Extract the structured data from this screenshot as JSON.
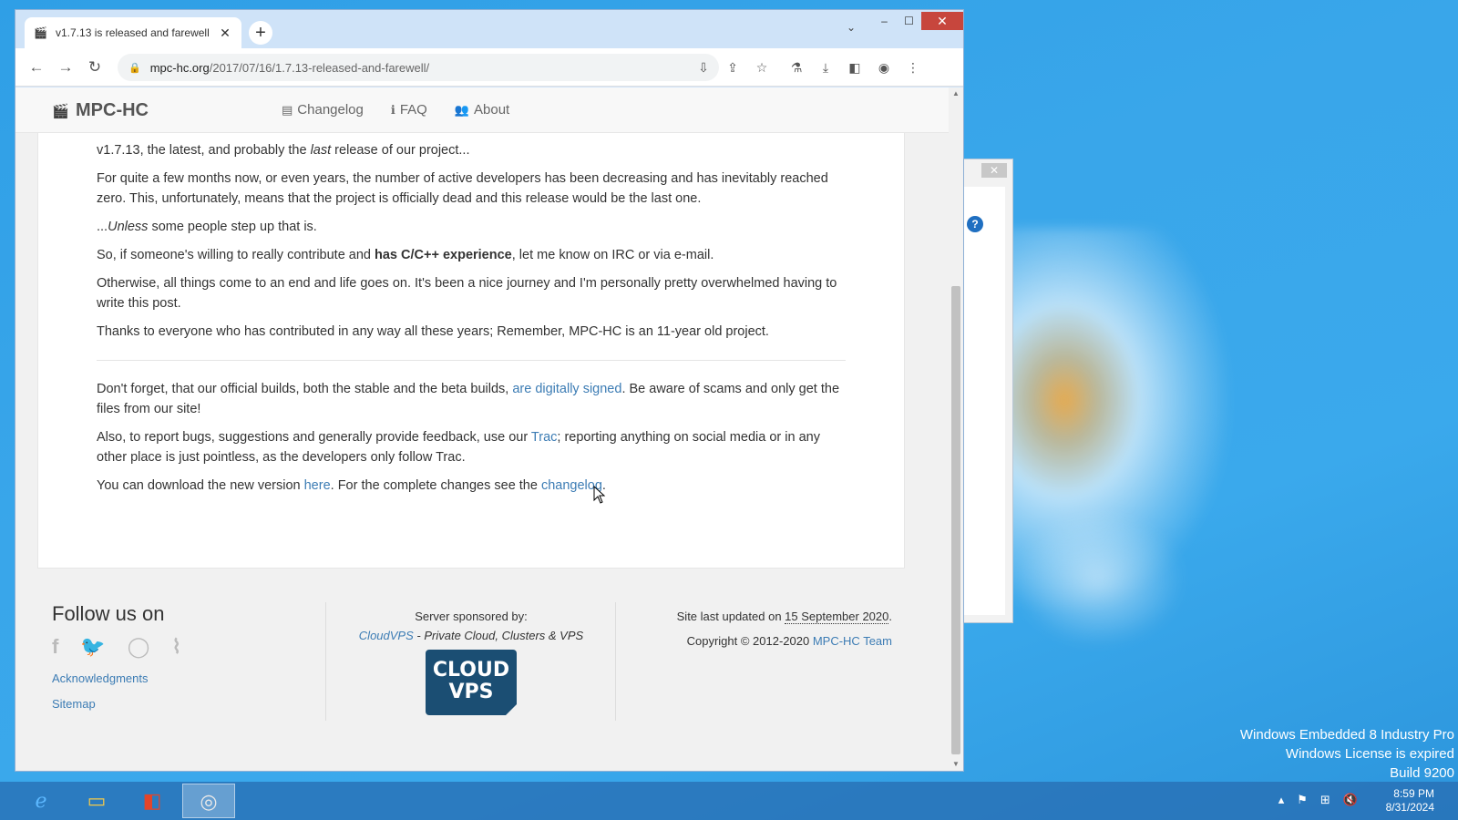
{
  "browser": {
    "tab_title": "v1.7.13 is released and farewell",
    "url_host": "mpc-hc.org",
    "url_path": "/2017/07/16/1.7.13-released-and-farewell/"
  },
  "site": {
    "brand": "MPC-HC",
    "nav": [
      {
        "label": "Changelog",
        "icon": "file-icon"
      },
      {
        "label": "FAQ",
        "icon": "info-icon"
      },
      {
        "label": "About",
        "icon": "users-icon"
      }
    ]
  },
  "article": {
    "p1_a": "v1.7.13, the latest, and probably the ",
    "p1_em": "last",
    "p1_b": " release of our project...",
    "p2": "For quite a few months now, or even years, the number of active developers has been decreasing and has inevitably reached zero. This, unfortunately, means that the project is officially dead and this release would be the last one.",
    "p3_a": "...",
    "p3_em": "Unless",
    "p3_b": " some people step up that is.",
    "p4_a": "So, if someone's willing to really contribute and ",
    "p4_strong": "has C/C++ experience",
    "p4_b": ", let me know on IRC or via e-mail.",
    "p5": "Otherwise, all things come to an end and life goes on. It's been a nice journey and I'm personally pretty overwhelmed having to write this post.",
    "p6": "Thanks to everyone who has contributed in any way all these years; Remember, MPC-HC is an 11-year old project.",
    "p7_a": "Don't forget, that our official builds, both the stable and the beta builds, ",
    "p7_link": "are digitally signed",
    "p7_b": ". Be aware of scams and only get the files from our site!",
    "p8_a": "Also, to report bugs, suggestions and generally provide feedback, use our ",
    "p8_link": "Trac",
    "p8_b": "; reporting anything on social media or in any other place is just pointless, as the developers only follow Trac.",
    "p9_a": "You can download the new version ",
    "p9_link1": "here",
    "p9_b": ". For the complete changes see the ",
    "p9_link2": "changelog",
    "p9_c": "."
  },
  "footer": {
    "follow": "Follow us on",
    "acknowledgments": "Acknowledgments",
    "sitemap": "Sitemap",
    "sponsored": "Server sponsored by:",
    "cloudvps_link": "CloudVPS",
    "cloudvps_desc": " - Private Cloud, Clusters & VPS",
    "logo_line1": "CLOUD",
    "logo_line2": "VPS",
    "updated_a": "Site last updated on ",
    "updated_date": "15 September 2020",
    "updated_b": ".",
    "copyright": "Copyright © 2012-2020 ",
    "team": "MPC-HC Team"
  },
  "desktop": {
    "watermark": [
      "Windows Embedded 8 Industry Pro",
      "Windows License is expired",
      "Build 9200"
    ],
    "time": "8:59 PM",
    "date": "8/31/2024"
  },
  "colors": {
    "link": "#3c7cb4",
    "close_button": "#c7463d",
    "desktop": "#39a6ea"
  }
}
